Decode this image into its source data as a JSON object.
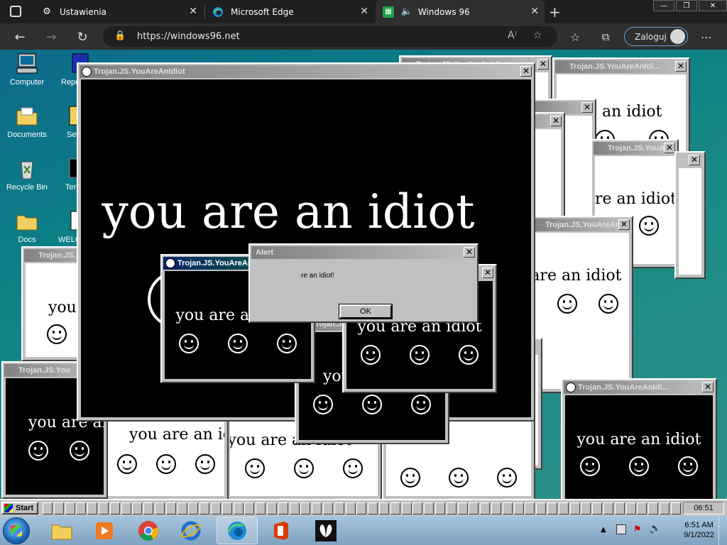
{
  "browser": {
    "tabs": [
      {
        "label": "Ustawienia",
        "icon": "gear-icon"
      },
      {
        "label": "Microsoft Edge",
        "icon": "edge-icon"
      },
      {
        "label": "Windows 96",
        "icon": "windows96-icon",
        "active": true
      }
    ],
    "url": "https://windows96.net",
    "signin_label": "Zaloguj"
  },
  "desktop": {
    "icons": [
      {
        "label": "Computer"
      },
      {
        "label": "Documents"
      },
      {
        "label": "Recycle Bin"
      },
      {
        "label": "Docs"
      },
      {
        "label": "Repo"
      },
      {
        "label": "Set"
      },
      {
        "label": "Ter"
      },
      {
        "label": "WELC"
      }
    ]
  },
  "popup": {
    "title": "Trojan.JS.YouAreAnIdiot",
    "title_short": "Trojan.JS.YouAreAnIdi...",
    "title_cut": "Trojan.JS.You",
    "message": "you are an idiot"
  },
  "alert": {
    "title": "Alert",
    "text": "re an idiot!",
    "ok_label": "OK"
  },
  "w96_taskbar": {
    "start_label": "Start",
    "clock": "06:51"
  },
  "win7_taskbar": {
    "time": "6:51 AM",
    "date": "9/1/2022"
  },
  "colors": {
    "chrome_bg": "#1f1f1f",
    "active_title": "#0a246a",
    "inactive_title": "#808080",
    "desktop_teal": "#0b7f86"
  }
}
